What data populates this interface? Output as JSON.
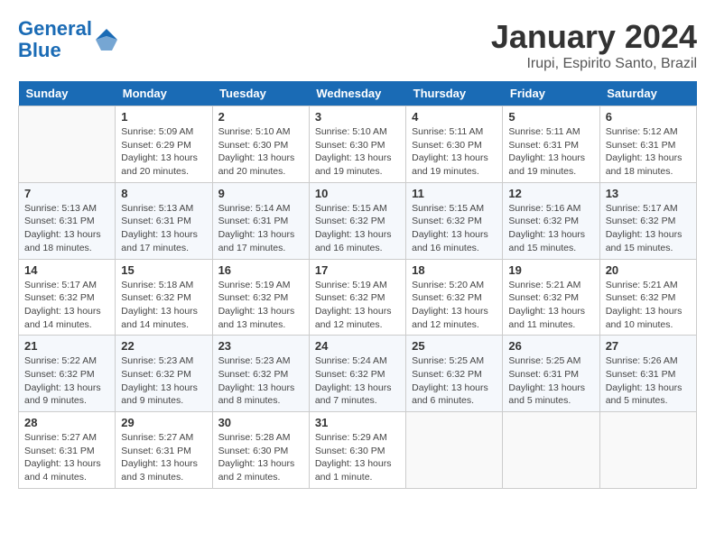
{
  "header": {
    "logo_line1": "General",
    "logo_line2": "Blue",
    "month": "January 2024",
    "location": "Irupi, Espirito Santo, Brazil"
  },
  "days_of_week": [
    "Sunday",
    "Monday",
    "Tuesday",
    "Wednesday",
    "Thursday",
    "Friday",
    "Saturday"
  ],
  "weeks": [
    [
      {
        "num": "",
        "empty": true
      },
      {
        "num": "1",
        "sunrise": "5:09 AM",
        "sunset": "6:29 PM",
        "daylight": "13 hours and 20 minutes."
      },
      {
        "num": "2",
        "sunrise": "5:10 AM",
        "sunset": "6:30 PM",
        "daylight": "13 hours and 20 minutes."
      },
      {
        "num": "3",
        "sunrise": "5:10 AM",
        "sunset": "6:30 PM",
        "daylight": "13 hours and 19 minutes."
      },
      {
        "num": "4",
        "sunrise": "5:11 AM",
        "sunset": "6:30 PM",
        "daylight": "13 hours and 19 minutes."
      },
      {
        "num": "5",
        "sunrise": "5:11 AM",
        "sunset": "6:31 PM",
        "daylight": "13 hours and 19 minutes."
      },
      {
        "num": "6",
        "sunrise": "5:12 AM",
        "sunset": "6:31 PM",
        "daylight": "13 hours and 18 minutes."
      }
    ],
    [
      {
        "num": "7",
        "sunrise": "5:13 AM",
        "sunset": "6:31 PM",
        "daylight": "13 hours and 18 minutes."
      },
      {
        "num": "8",
        "sunrise": "5:13 AM",
        "sunset": "6:31 PM",
        "daylight": "13 hours and 17 minutes."
      },
      {
        "num": "9",
        "sunrise": "5:14 AM",
        "sunset": "6:31 PM",
        "daylight": "13 hours and 17 minutes."
      },
      {
        "num": "10",
        "sunrise": "5:15 AM",
        "sunset": "6:32 PM",
        "daylight": "13 hours and 16 minutes."
      },
      {
        "num": "11",
        "sunrise": "5:15 AM",
        "sunset": "6:32 PM",
        "daylight": "13 hours and 16 minutes."
      },
      {
        "num": "12",
        "sunrise": "5:16 AM",
        "sunset": "6:32 PM",
        "daylight": "13 hours and 15 minutes."
      },
      {
        "num": "13",
        "sunrise": "5:17 AM",
        "sunset": "6:32 PM",
        "daylight": "13 hours and 15 minutes."
      }
    ],
    [
      {
        "num": "14",
        "sunrise": "5:17 AM",
        "sunset": "6:32 PM",
        "daylight": "13 hours and 14 minutes."
      },
      {
        "num": "15",
        "sunrise": "5:18 AM",
        "sunset": "6:32 PM",
        "daylight": "13 hours and 14 minutes."
      },
      {
        "num": "16",
        "sunrise": "5:19 AM",
        "sunset": "6:32 PM",
        "daylight": "13 hours and 13 minutes."
      },
      {
        "num": "17",
        "sunrise": "5:19 AM",
        "sunset": "6:32 PM",
        "daylight": "13 hours and 12 minutes."
      },
      {
        "num": "18",
        "sunrise": "5:20 AM",
        "sunset": "6:32 PM",
        "daylight": "13 hours and 12 minutes."
      },
      {
        "num": "19",
        "sunrise": "5:21 AM",
        "sunset": "6:32 PM",
        "daylight": "13 hours and 11 minutes."
      },
      {
        "num": "20",
        "sunrise": "5:21 AM",
        "sunset": "6:32 PM",
        "daylight": "13 hours and 10 minutes."
      }
    ],
    [
      {
        "num": "21",
        "sunrise": "5:22 AM",
        "sunset": "6:32 PM",
        "daylight": "13 hours and 9 minutes."
      },
      {
        "num": "22",
        "sunrise": "5:23 AM",
        "sunset": "6:32 PM",
        "daylight": "13 hours and 9 minutes."
      },
      {
        "num": "23",
        "sunrise": "5:23 AM",
        "sunset": "6:32 PM",
        "daylight": "13 hours and 8 minutes."
      },
      {
        "num": "24",
        "sunrise": "5:24 AM",
        "sunset": "6:32 PM",
        "daylight": "13 hours and 7 minutes."
      },
      {
        "num": "25",
        "sunrise": "5:25 AM",
        "sunset": "6:32 PM",
        "daylight": "13 hours and 6 minutes."
      },
      {
        "num": "26",
        "sunrise": "5:25 AM",
        "sunset": "6:31 PM",
        "daylight": "13 hours and 5 minutes."
      },
      {
        "num": "27",
        "sunrise": "5:26 AM",
        "sunset": "6:31 PM",
        "daylight": "13 hours and 5 minutes."
      }
    ],
    [
      {
        "num": "28",
        "sunrise": "5:27 AM",
        "sunset": "6:31 PM",
        "daylight": "13 hours and 4 minutes."
      },
      {
        "num": "29",
        "sunrise": "5:27 AM",
        "sunset": "6:31 PM",
        "daylight": "13 hours and 3 minutes."
      },
      {
        "num": "30",
        "sunrise": "5:28 AM",
        "sunset": "6:30 PM",
        "daylight": "13 hours and 2 minutes."
      },
      {
        "num": "31",
        "sunrise": "5:29 AM",
        "sunset": "6:30 PM",
        "daylight": "13 hours and 1 minute."
      },
      {
        "num": "",
        "empty": true
      },
      {
        "num": "",
        "empty": true
      },
      {
        "num": "",
        "empty": true
      }
    ]
  ],
  "labels": {
    "sunrise": "Sunrise:",
    "sunset": "Sunset:",
    "daylight": "Daylight:"
  }
}
